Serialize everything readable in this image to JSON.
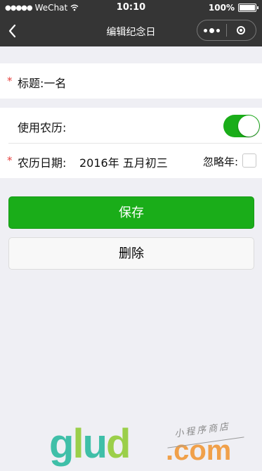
{
  "status_bar": {
    "signal_dots": "●●●●●",
    "carrier": "WeChat",
    "wifi_icon": "wifi-icon",
    "time": "10:10",
    "battery": "100%"
  },
  "nav": {
    "title": "编辑纪念日",
    "back_icon": "back-arrow-icon",
    "more_icon": "more-dots-icon",
    "close_icon": "capsule-close-icon"
  },
  "form": {
    "title_required": "*",
    "title_label": "标题:一名",
    "lunar_label": "使用农历:",
    "lunar_enabled": true,
    "date_required": "*",
    "date_label": "农历日期:",
    "date_value": "2016年 五月初三",
    "ignore_year_label": "忽略年:",
    "ignore_year_checked": false
  },
  "buttons": {
    "save": "保存",
    "delete": "删除"
  },
  "watermark": {
    "brand": "glud",
    "domain": ".com",
    "tagline": "小程序商店"
  },
  "colors": {
    "primary": "#1aad19",
    "danger_star": "#e64340",
    "navbar": "#353535"
  }
}
